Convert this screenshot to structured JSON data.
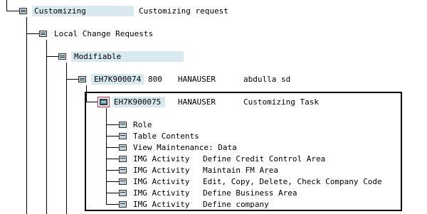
{
  "tree": {
    "customizing": {
      "label": "Customizing",
      "description": "Customizing request"
    },
    "local_change_requests": {
      "label": "Local Change Requests"
    },
    "modifiable": {
      "label": "Modifiable"
    },
    "request": {
      "id": "EH7K900074",
      "client": "800",
      "owner": "HANAUSER",
      "text": "abdulla sd"
    },
    "task": {
      "id": "EH7K900075",
      "owner": "HANAUSER",
      "text": "Customizing Task"
    },
    "objects": [
      {
        "type": "Role",
        "name": ""
      },
      {
        "type": "Table Contents",
        "name": ""
      },
      {
        "type": "View Maintenance: Data",
        "name": ""
      },
      {
        "type": "IMG Activity",
        "name": "Define Credit Control Area"
      },
      {
        "type": "IMG Activity",
        "name": "Maintain FM Area"
      },
      {
        "type": "IMG Activity",
        "name": "Edit, Copy, Delete, Check Company Code"
      },
      {
        "type": "IMG Activity",
        "name": "Define Business Area"
      },
      {
        "type": "IMG Activity",
        "name": "Define company"
      }
    ]
  },
  "colors": {
    "highlight": "#d8eaf0",
    "folder": "#bcd3dc",
    "selected_folder": "#3c6a86",
    "selection_frame": "#cf2d2d"
  },
  "icons": {
    "folder": "open-folder-icon",
    "object": "plus-folder-icon"
  }
}
